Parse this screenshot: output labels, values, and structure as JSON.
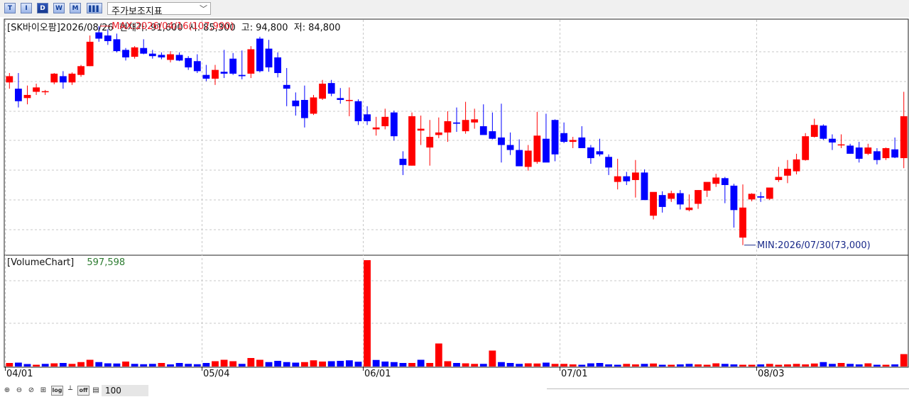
{
  "toolbar": {
    "period_buttons": [
      {
        "label": "T",
        "active": false
      },
      {
        "label": "I",
        "active": false
      },
      {
        "label": "D",
        "active": true
      },
      {
        "label": "W",
        "active": false
      },
      {
        "label": "M",
        "active": false
      }
    ],
    "indicator_select": "주가보조지표"
  },
  "bottombar": {
    "buttons": [
      "log",
      "off"
    ],
    "zoom_value": "100"
  },
  "colors": {
    "up": "#ff0000",
    "down": "#0000ff",
    "max_label": "#e8202a",
    "min_label": "#1a2a8a",
    "volume_value": "#2e7d32"
  },
  "chart_data": [
    {
      "type": "candlestick",
      "header": {
        "stock": "SK바이오팜",
        "date": "2026/08/26",
        "current_label": "현재가:",
        "current": "91,600",
        "open_label": "시:",
        "open": "85,300",
        "high_label": "고:",
        "high": "94,800",
        "low_label": "저:",
        "low": "84,800"
      },
      "max_annotation": "MAX:2026/04/16(107,900)",
      "min_annotation": "MIN:2026/07/30(73,000)",
      "x_tick_labels": [
        "04/01",
        "05/04",
        "06/01",
        "07/01",
        "08/03"
      ],
      "x_tick_index": [
        0,
        22,
        40,
        62,
        84
      ],
      "ylim": [
        71500,
        109000
      ],
      "grid": true,
      "candles": [
        [
          99000,
          100500,
          98000,
          100000
        ],
        [
          98000,
          100500,
          95000,
          96000
        ],
        [
          96500,
          98500,
          95500,
          97000
        ],
        [
          97500,
          98800,
          97000,
          98200
        ],
        [
          97500,
          97800,
          97000,
          97600
        ],
        [
          99000,
          100500,
          98700,
          100400
        ],
        [
          100000,
          100800,
          98000,
          99000
        ],
        [
          99000,
          100600,
          98600,
          100400
        ],
        [
          100200,
          101800,
          99900,
          101600
        ],
        [
          101600,
          106500,
          101600,
          105500
        ],
        [
          107000,
          108000,
          105500,
          106000
        ],
        [
          106500,
          107500,
          105000,
          105600
        ],
        [
          105900,
          106800,
          103800,
          104000
        ],
        [
          104200,
          104500,
          102500,
          103000
        ],
        [
          103100,
          104800,
          102800,
          104600
        ],
        [
          104500,
          105900,
          103500,
          103600
        ],
        [
          103600,
          104200,
          102800,
          103200
        ],
        [
          103400,
          103800,
          102700,
          103000
        ],
        [
          102600,
          104000,
          102200,
          103500
        ],
        [
          103400,
          103800,
          102400,
          102500
        ],
        [
          102900,
          103200,
          101000,
          101400
        ],
        [
          102400,
          103500,
          100500,
          100800
        ],
        [
          100200,
          101800,
          99200,
          99600
        ],
        [
          99600,
          101800,
          98600,
          101000
        ],
        [
          100700,
          104200,
          99700,
          100400
        ],
        [
          102800,
          103700,
          100200,
          100400
        ],
        [
          100200,
          104100,
          99500,
          100000
        ],
        [
          100400,
          104800,
          99700,
          104300
        ],
        [
          106000,
          106300,
          100600,
          100800
        ],
        [
          104400,
          105800,
          100700,
          101400
        ],
        [
          103000,
          103800,
          99800,
          100500
        ],
        [
          98600,
          101300,
          95200,
          98000
        ],
        [
          96100,
          97400,
          93700,
          95200
        ],
        [
          96200,
          98500,
          91800,
          93300
        ],
        [
          94000,
          97000,
          93800,
          96600
        ],
        [
          96400,
          99400,
          96200,
          98800
        ],
        [
          98900,
          99400,
          96800,
          97200
        ],
        [
          96500,
          98100,
          95600,
          96200
        ],
        [
          96100,
          98200,
          93600,
          96200
        ],
        [
          96000,
          96300,
          92200,
          92800
        ],
        [
          93900,
          95200,
          92200,
          92800
        ],
        [
          91500,
          93500,
          90500,
          91800
        ],
        [
          92000,
          94800,
          91500,
          93500
        ],
        [
          94200,
          94500,
          89700,
          90400
        ],
        [
          86800,
          88000,
          84200,
          85800
        ],
        [
          85700,
          94200,
          85700,
          93600
        ],
        [
          91300,
          93700,
          89000,
          91600
        ],
        [
          88600,
          93000,
          85700,
          90300
        ],
        [
          90600,
          93400,
          90100,
          91000
        ],
        [
          91000,
          94400,
          89500,
          92800
        ],
        [
          92600,
          95000,
          91100,
          92400
        ],
        [
          91200,
          95900,
          90800,
          93000
        ],
        [
          92600,
          94800,
          91600,
          93100
        ],
        [
          92000,
          95500,
          90800,
          90600
        ],
        [
          91200,
          94200,
          89900,
          90000
        ],
        [
          90200,
          95600,
          86200,
          89000
        ],
        [
          89000,
          91000,
          87400,
          88200
        ],
        [
          88200,
          89900,
          85700,
          85600
        ],
        [
          85500,
          89000,
          84900,
          88100
        ],
        [
          86300,
          94300,
          86000,
          90500
        ],
        [
          90000,
          94000,
          86500,
          86200
        ],
        [
          93000,
          93100,
          86400,
          87500
        ],
        [
          90900,
          92600,
          89300,
          89500
        ],
        [
          89500,
          90300,
          88500,
          89800
        ],
        [
          90200,
          92000,
          89800,
          88500
        ],
        [
          88600,
          89000,
          86000,
          86900
        ],
        [
          88000,
          90000,
          87200,
          87500
        ],
        [
          87100,
          87500,
          84200,
          85400
        ],
        [
          83100,
          86800,
          81900,
          84000
        ],
        [
          84000,
          84700,
          82600,
          83200
        ],
        [
          83400,
          86600,
          80600,
          84600
        ],
        [
          84600,
          85100,
          83300,
          80200
        ],
        [
          77700,
          81400,
          77100,
          81500
        ],
        [
          81000,
          81600,
          78200,
          79100
        ],
        [
          80400,
          81700,
          79900,
          81300
        ],
        [
          81300,
          81800,
          78700,
          79500
        ],
        [
          78600,
          81100,
          78400,
          79000
        ],
        [
          79600,
          81800,
          78800,
          81800
        ],
        [
          81700,
          82900,
          80700,
          83100
        ],
        [
          82800,
          84400,
          82300,
          83800
        ],
        [
          83700,
          83900,
          79700,
          82600
        ],
        [
          82500,
          82800,
          75800,
          78600
        ],
        [
          74200,
          82700,
          73000,
          79000
        ],
        [
          80300,
          81300,
          80000,
          81200
        ],
        [
          80800,
          81500,
          79900,
          80600
        ],
        [
          80400,
          82100,
          80200,
          82200
        ],
        [
          83400,
          85500,
          83100,
          83900
        ],
        [
          84100,
          86600,
          82900,
          85200
        ],
        [
          84800,
          87600,
          84300,
          86700
        ],
        [
          86600,
          90900,
          86500,
          90400
        ],
        [
          90300,
          93200,
          90200,
          92200
        ],
        [
          92100,
          92300,
          89800,
          90000
        ],
        [
          90000,
          90700,
          88200,
          89400
        ],
        [
          89000,
          90700,
          88500,
          89100
        ],
        [
          88900,
          89200,
          87600,
          87600
        ],
        [
          88600,
          89500,
          86200,
          86800
        ],
        [
          87600,
          89200,
          87400,
          88600
        ],
        [
          88000,
          88500,
          85900,
          86600
        ],
        [
          86900,
          88600,
          86600,
          88500
        ],
        [
          88300,
          90200,
          86900,
          87000
        ],
        [
          86900,
          97500,
          85300,
          93600
        ]
      ]
    },
    {
      "type": "bar",
      "title": "VolumeChart",
      "value": "597,598",
      "ylim": [
        0,
        620000
      ],
      "grid": true,
      "values": [
        20000,
        22000,
        14000,
        10000,
        15000,
        18000,
        20000,
        15000,
        25000,
        38000,
        25000,
        18000,
        17000,
        28000,
        15000,
        13000,
        15000,
        20000,
        12000,
        20000,
        15000,
        13000,
        20000,
        30000,
        38000,
        30000,
        15000,
        48000,
        38000,
        25000,
        32000,
        25000,
        22000,
        25000,
        35000,
        28000,
        30000,
        32000,
        35000,
        27000,
        600000,
        37000,
        28000,
        25000,
        20000,
        20000,
        38000,
        20000,
        130000,
        30000,
        20000,
        18000,
        15000,
        15000,
        90000,
        25000,
        20000,
        15000,
        18000,
        17000,
        22000,
        15000,
        15000,
        12000,
        10000,
        18000,
        20000,
        12000,
        10000,
        15000,
        12000,
        15000,
        17000,
        10000,
        10000,
        12000,
        15000,
        12000,
        10000,
        18000,
        15000,
        12000,
        10000,
        10000,
        12000,
        15000,
        10000,
        12000,
        15000,
        12000,
        17000,
        25000,
        15000,
        20000,
        15000,
        12000,
        18000,
        10000,
        10000,
        12000,
        70000
      ],
      "directions": [
        1,
        0,
        0,
        1,
        0,
        1,
        0,
        1,
        1,
        1,
        0,
        0,
        0,
        1,
        0,
        0,
        0,
        1,
        0,
        0,
        0,
        0,
        0,
        1,
        1,
        1,
        0,
        1,
        1,
        0,
        0,
        0,
        0,
        1,
        1,
        1,
        0,
        0,
        0,
        0,
        1,
        0,
        0,
        0,
        0,
        1,
        0,
        1,
        1,
        1,
        0,
        1,
        1,
        0,
        1,
        0,
        0,
        0,
        1,
        1,
        0,
        1,
        1,
        1,
        0,
        0,
        0,
        0,
        0,
        1,
        1,
        0,
        1,
        0,
        1,
        0,
        0,
        1,
        1,
        1,
        0,
        0,
        1,
        1,
        0,
        1,
        1,
        1,
        1,
        1,
        1,
        0,
        0,
        1,
        0,
        0,
        1,
        0,
        1,
        0,
        1
      ]
    }
  ]
}
